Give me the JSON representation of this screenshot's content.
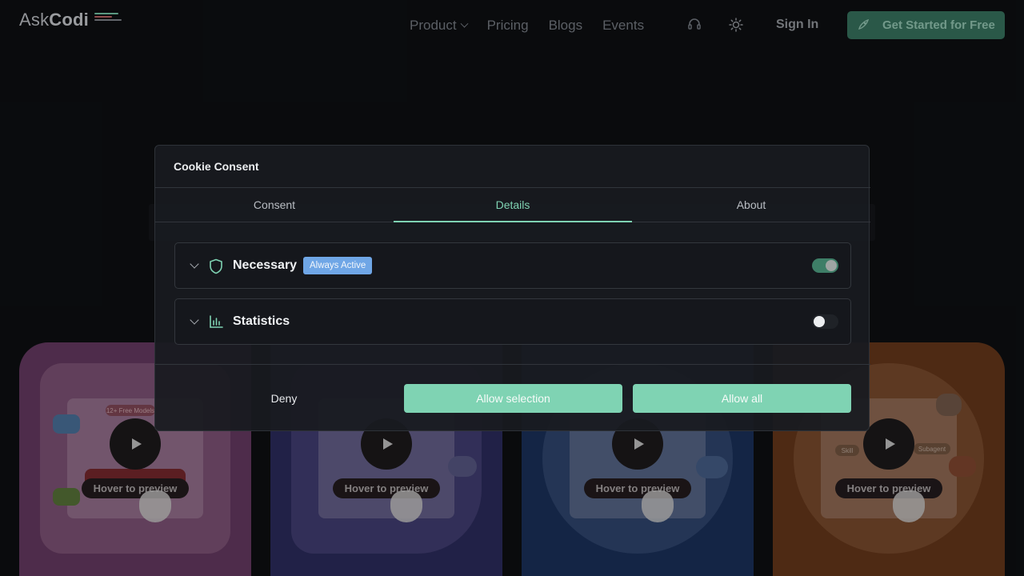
{
  "header": {
    "logo_prefix": "Ask",
    "logo_bold": "Codi",
    "nav": [
      "Product",
      "Pricing",
      "Blogs",
      "Events"
    ],
    "signin": "Sign In",
    "cta": "Get Started for Free"
  },
  "cards": [
    {
      "hover_label": "Hover to preview",
      "tag": "12+ Free Models"
    },
    {
      "hover_label": "Hover to preview"
    },
    {
      "hover_label": "Hover to preview"
    },
    {
      "hover_label": "Hover to preview",
      "chips": [
        "Skill",
        "Subagent"
      ]
    }
  ],
  "modal": {
    "title": "Cookie Consent",
    "tabs": [
      "Consent",
      "Details",
      "About"
    ],
    "active_tab": "Details",
    "sections": [
      {
        "name": "Necessary",
        "badge": "Always Active",
        "enabled": true,
        "icon": "shield-icon"
      },
      {
        "name": "Statistics",
        "enabled": false,
        "icon": "bar-chart-icon"
      }
    ],
    "buttons": {
      "deny": "Deny",
      "allow_selection": "Allow selection",
      "allow_all": "Allow all"
    }
  },
  "colors": {
    "accent": "#7fd3b3",
    "badge": "#6fa6e6",
    "cta": "#3b7a64"
  }
}
